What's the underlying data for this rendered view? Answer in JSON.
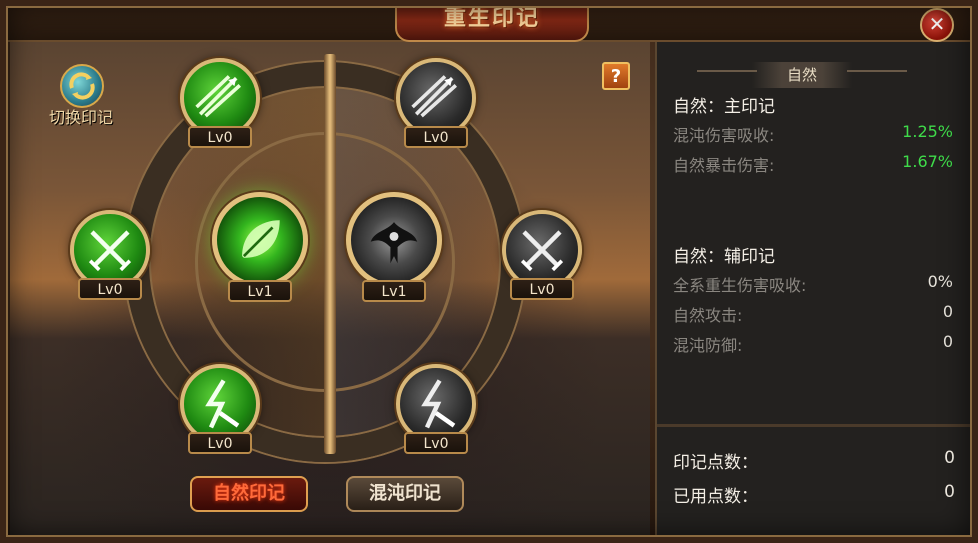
{
  "window": {
    "title": "重生印记",
    "close_symbol": "✕"
  },
  "switch_mark": {
    "label": "切换印记",
    "icon": "swap-arrows-icon"
  },
  "help": {
    "label": "?"
  },
  "left_nodes": [
    {
      "level": "Lv0",
      "icon": "arrow-burst-icon"
    },
    {
      "level": "Lv0",
      "icon": "crossed-swords-icon"
    },
    {
      "level": "Lv1",
      "icon": "leaf-icon"
    },
    {
      "level": "Lv0",
      "icon": "lightning-sword-icon"
    }
  ],
  "right_nodes": [
    {
      "level": "Lv0",
      "icon": "arrow-burst-icon"
    },
    {
      "level": "Lv1",
      "icon": "tribal-emblem-icon"
    },
    {
      "level": "Lv0",
      "icon": "crossed-swords-icon"
    },
    {
      "level": "Lv0",
      "icon": "lightning-sword-icon"
    }
  ],
  "tabs": [
    {
      "label": "自然印记",
      "active": true
    },
    {
      "label": "混沌印记",
      "active": false
    }
  ],
  "panel": {
    "header": "自然",
    "main": {
      "title": "自然：主印记",
      "stats": [
        {
          "name": "混沌伤害吸收:",
          "value": "1.25%"
        },
        {
          "name": "自然暴击伤害:",
          "value": "1.67%"
        }
      ]
    },
    "aux": {
      "title": "自然：辅印记",
      "stats": [
        {
          "name": "全系重生伤害吸收:",
          "value": "0%"
        },
        {
          "name": "自然攻击:",
          "value": "0"
        },
        {
          "name": "混沌防御:",
          "value": "0"
        }
      ]
    },
    "points": [
      {
        "name": "印记点数：",
        "value": "0"
      },
      {
        "name": "已用点数：",
        "value": "0"
      }
    ]
  },
  "colors": {
    "accent_green": "#3fdc4a",
    "active_tab_text": "#ff6a3a",
    "title_glow": "#ff7a30"
  }
}
